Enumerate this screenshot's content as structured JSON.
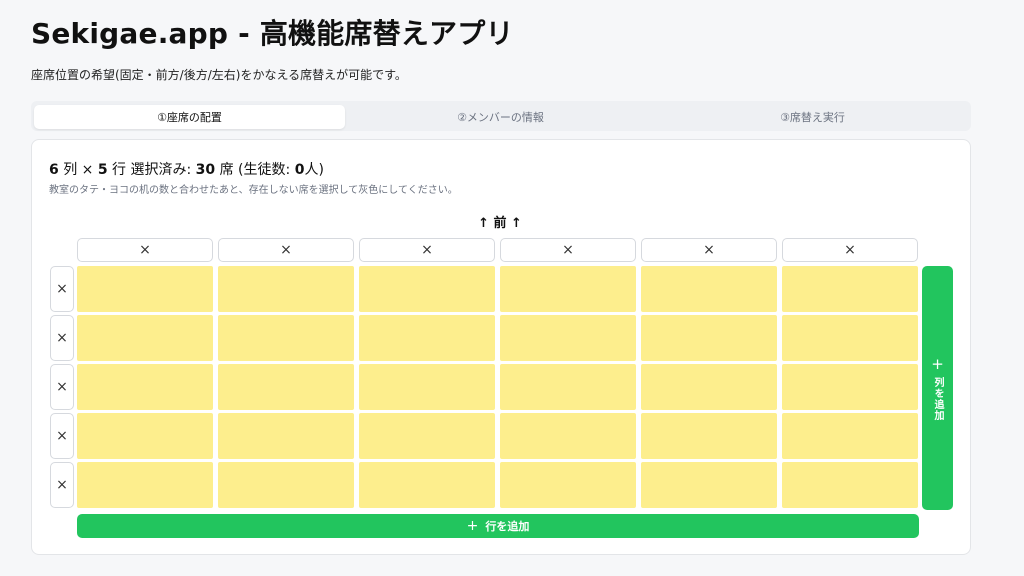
{
  "app": {
    "title": "Sekigae.app - 高機能席替えアプリ",
    "subtitle": "座席位置の希望(固定・前方/後方/左右)をかなえる席替えが可能です。"
  },
  "tabs": [
    {
      "label": "①座席の配置",
      "active": true
    },
    {
      "label": "②メンバーの情報",
      "active": false
    },
    {
      "label": "③席替え実行",
      "active": false
    }
  ],
  "layout_panel": {
    "cols": "6",
    "cols_unit": "列 ×",
    "rows": "5",
    "rows_unit": "行 選択済み:",
    "selected": "30",
    "selected_unit": "席 (生徒数:",
    "students": "0",
    "students_unit": "人)",
    "hint": "教室のタテ・ヨコの机の数と合わせたあと、存在しない席を選択して灰色にしてください。",
    "front_label": "↑ 前 ↑",
    "delete_glyph": "×",
    "add_col": {
      "icon": "plus-icon",
      "plus": "+",
      "label": "列を追加"
    },
    "add_row": {
      "icon": "plus-icon",
      "plus": "+",
      "label": "行を追加"
    },
    "seat_color": "#fdee8d",
    "seat_state": "available",
    "accent_color": "#22c55e"
  }
}
